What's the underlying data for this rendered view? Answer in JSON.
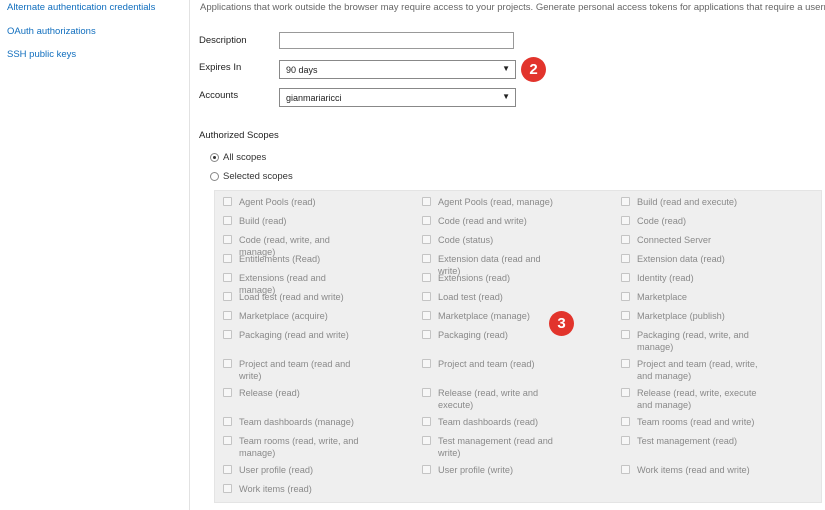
{
  "sidebar": {
    "links": [
      {
        "label": "Alternate authentication credentials"
      },
      {
        "label": "OAuth authorizations"
      },
      {
        "label": "SSH public keys"
      }
    ]
  },
  "intro_text": "Applications that work outside the browser may require access to your projects. Generate personal access tokens for applications that require a userna",
  "form": {
    "description_label": "Description",
    "description_value": "",
    "expires_label": "Expires In",
    "expires_value": "90 days",
    "accounts_label": "Accounts",
    "accounts_value": "gianmariaricci"
  },
  "badges": {
    "expires": "2",
    "scopes": "3"
  },
  "scopes_section": {
    "title": "Authorized Scopes",
    "all_scopes_label": "All scopes",
    "selected_scopes_label": "Selected scopes",
    "all_selected": true
  },
  "scopes": [
    [
      "Agent Pools (read)",
      "Agent Pools (read, manage)",
      "Build (read and execute)"
    ],
    [
      "Build (read)",
      "Code (read and write)",
      "Code (read)"
    ],
    [
      "Code (read, write, and manage)",
      "Code (status)",
      "Connected Server"
    ],
    [
      "Entitlements (Read)",
      "Extension data (read and write)",
      "Extension data (read)"
    ],
    [
      "Extensions (read and manage)",
      "Extensions (read)",
      "Identity (read)"
    ],
    [
      "Load test (read and write)",
      "Load test (read)",
      "Marketplace"
    ],
    [
      "Marketplace (acquire)",
      "Marketplace (manage)",
      "Marketplace (publish)"
    ],
    [
      "Packaging (read and write)",
      "Packaging (read)",
      "Packaging (read, write, and manage)"
    ],
    [
      "Project and team (read and write)",
      "Project and team (read)",
      "Project and team (read, write, and manage)"
    ],
    [
      "Release (read)",
      "Release (read, write and execute)",
      "Release (read, write, execute and manage)"
    ],
    [
      "Team dashboards (manage)",
      "Team dashboards (read)",
      "Team rooms (read and write)"
    ],
    [
      "Team rooms (read, write, and manage)",
      "Test management (read and write)",
      "Test management (read)"
    ],
    [
      "User profile (read)",
      "User profile (write)",
      "Work items (read and write)"
    ],
    [
      "Work items (read)"
    ]
  ]
}
